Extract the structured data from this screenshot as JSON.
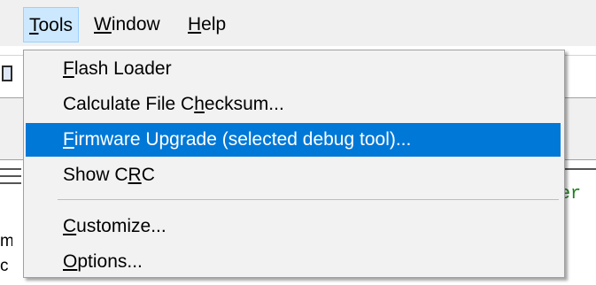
{
  "menubar": {
    "items": [
      {
        "pre": "",
        "key": "T",
        "post": "ools"
      },
      {
        "pre": "",
        "key": "W",
        "post": "indow"
      },
      {
        "pre": "",
        "key": "H",
        "post": "elp"
      }
    ]
  },
  "background": {
    "code_fragment": "er",
    "left_text_1": "m",
    "left_text_2": "c"
  },
  "tools_menu": {
    "items": [
      {
        "pre": "",
        "key": "F",
        "post": "lash Loader"
      },
      {
        "pre": "Calculate File C",
        "key": "h",
        "post": "ecksum..."
      },
      {
        "pre": "",
        "key": "F",
        "post": "irmware Upgrade (selected debug tool)..."
      },
      {
        "pre": "Show C",
        "key": "R",
        "post": "C"
      },
      {
        "pre": "",
        "key": "C",
        "post": "ustomize..."
      },
      {
        "pre": "",
        "key": "O",
        "post": "ptions..."
      }
    ],
    "selected_index": 2
  },
  "colors": {
    "selection": "#0078d7",
    "menu_open_highlight": "#cce8ff",
    "code_green": "#1a7f1a"
  }
}
